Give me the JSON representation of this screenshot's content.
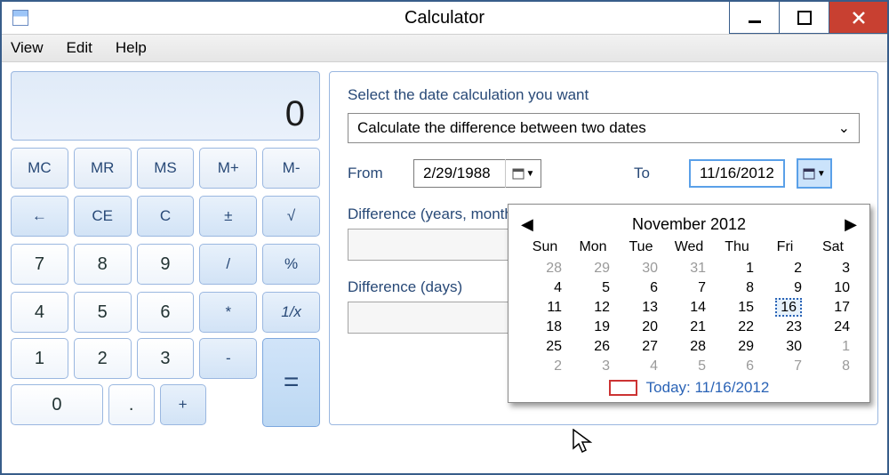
{
  "window": {
    "title": "Calculator"
  },
  "menu": [
    "View",
    "Edit",
    "Help"
  ],
  "calc": {
    "display": "0",
    "mem": [
      "MC",
      "MR",
      "MS",
      "M+",
      "M-"
    ],
    "row2": [
      "←",
      "CE",
      "C",
      "±",
      "√"
    ],
    "row3": [
      "7",
      "8",
      "9",
      "/",
      "%"
    ],
    "row4": [
      "4",
      "5",
      "6",
      "*",
      "1/x"
    ],
    "row5": [
      "1",
      "2",
      "3",
      "-"
    ],
    "row6": [
      "0",
      ".",
      "+"
    ],
    "eq": "="
  },
  "datecalc": {
    "prompt": "Select the date calculation you want",
    "combo": "Calculate the difference between two dates",
    "from_label": "From",
    "to_label": "To",
    "from_value": "2/29/1988",
    "to_value": "11/16/2012",
    "diff_ym_label": "Difference (years, months",
    "diff_days_label": "Difference (days)"
  },
  "calendar": {
    "month_title": "November 2012",
    "dow": [
      "Sun",
      "Mon",
      "Tue",
      "Wed",
      "Thu",
      "Fri",
      "Sat"
    ],
    "cells": [
      {
        "d": "28",
        "o": true
      },
      {
        "d": "29",
        "o": true
      },
      {
        "d": "30",
        "o": true
      },
      {
        "d": "31",
        "o": true
      },
      {
        "d": "1"
      },
      {
        "d": "2"
      },
      {
        "d": "3"
      },
      {
        "d": "4"
      },
      {
        "d": "5"
      },
      {
        "d": "6"
      },
      {
        "d": "7"
      },
      {
        "d": "8"
      },
      {
        "d": "9"
      },
      {
        "d": "10"
      },
      {
        "d": "11"
      },
      {
        "d": "12"
      },
      {
        "d": "13"
      },
      {
        "d": "14"
      },
      {
        "d": "15"
      },
      {
        "d": "16",
        "sel": true
      },
      {
        "d": "17"
      },
      {
        "d": "18"
      },
      {
        "d": "19"
      },
      {
        "d": "20"
      },
      {
        "d": "21"
      },
      {
        "d": "22"
      },
      {
        "d": "23"
      },
      {
        "d": "24"
      },
      {
        "d": "25"
      },
      {
        "d": "26"
      },
      {
        "d": "27"
      },
      {
        "d": "28"
      },
      {
        "d": "29"
      },
      {
        "d": "30"
      },
      {
        "d": "1",
        "o": true
      },
      {
        "d": "2",
        "o": true
      },
      {
        "d": "3",
        "o": true
      },
      {
        "d": "4",
        "o": true
      },
      {
        "d": "5",
        "o": true
      },
      {
        "d": "6",
        "o": true
      },
      {
        "d": "7",
        "o": true
      },
      {
        "d": "8",
        "o": true
      }
    ],
    "today_text": "Today: 11/16/2012"
  }
}
